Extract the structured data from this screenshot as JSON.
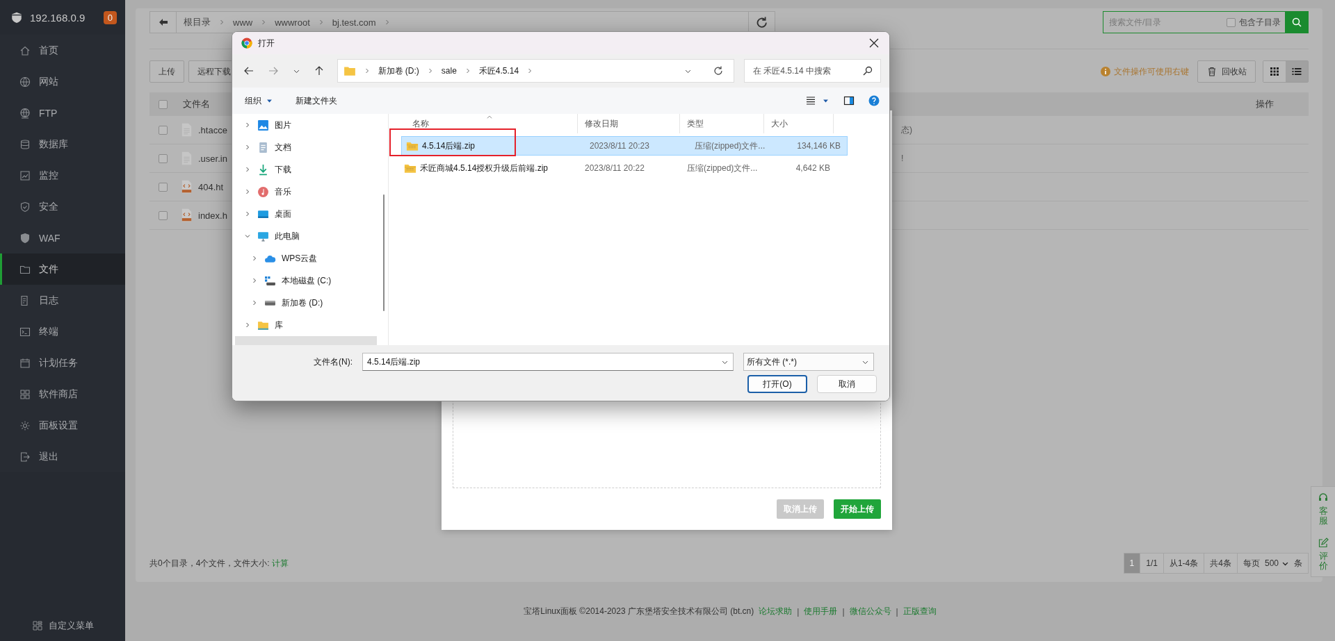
{
  "sidebar": {
    "host": "192.168.0.9",
    "badge": "0",
    "items": [
      {
        "label": "首页",
        "selected": false
      },
      {
        "label": "网站",
        "selected": false
      },
      {
        "label": "FTP",
        "selected": false
      },
      {
        "label": "数据库",
        "selected": false
      },
      {
        "label": "监控",
        "selected": false
      },
      {
        "label": "安全",
        "selected": false
      },
      {
        "label": "WAF",
        "selected": false
      },
      {
        "label": "文件",
        "selected": true
      },
      {
        "label": "日志",
        "selected": false
      },
      {
        "label": "终端",
        "selected": false
      },
      {
        "label": "计划任务",
        "selected": false
      },
      {
        "label": "软件商店",
        "selected": false
      },
      {
        "label": "面板设置",
        "selected": false
      },
      {
        "label": "退出",
        "selected": false
      }
    ],
    "custom_menu": "自定义菜单"
  },
  "file_manager": {
    "breadcrumb": [
      "根目录",
      "www",
      "wwwroot",
      "bj.test.com"
    ],
    "search": {
      "placeholder": "搜索文件/目录",
      "subdir_label": "包含子目录",
      "subdir_checked": false
    },
    "buttons": [
      "上传",
      "远程下载"
    ],
    "hint": "文件操作可使用右键",
    "recycle_bin": "回收站",
    "views": [
      {
        "kind": "grid",
        "selected": false
      },
      {
        "kind": "list",
        "selected": true
      }
    ],
    "columns": [
      "文件名",
      "操作"
    ],
    "select_all_checked": false,
    "rows": [
      {
        "name": ".htacce",
        "kind": "text",
        "checked": false,
        "column_3": "态)"
      },
      {
        "name": ".user.in",
        "kind": "text",
        "checked": false,
        "column_3": "!"
      },
      {
        "name": "404.ht",
        "kind": "html",
        "checked": false
      },
      {
        "name": "index.h",
        "kind": "html",
        "checked": false
      }
    ],
    "summary": "共0个目录，4个文件，文件大小: ",
    "calc_link": "计算",
    "pagination": {
      "pages": [
        {
          "label": "1",
          "selected": true
        }
      ],
      "page_count": "1/1",
      "range": "从1-4条",
      "total": "共4条",
      "per_page_label": "每页",
      "per_page": "500",
      "unit": "条"
    }
  },
  "upload_dialog": {
    "cancel": {
      "label": "取消上传",
      "disabled": true
    },
    "start": {
      "label": "开始上传",
      "disabled": false
    }
  },
  "footer": {
    "copyright": "宝塔Linux面板 ©2014-2023 广东堡塔安全技术有限公司 (bt.cn)",
    "links": [
      "论坛求助",
      "使用手册",
      "微信公众号",
      "正版查询"
    ],
    "separator": "|"
  },
  "float_panel": [
    "客服",
    "评价"
  ],
  "open_dialog": {
    "title": "打开",
    "path": [
      "新加卷 (D:)",
      "sale",
      "禾匠4.5.14"
    ],
    "search_placeholder": "在 禾匠4.5.14 中搜索",
    "commands": [
      {
        "label": "组织",
        "dropdown": true
      },
      {
        "label": "新建文件夹",
        "dropdown": false
      }
    ],
    "nav": [
      {
        "label": "图片",
        "expanded": false,
        "selected": false
      },
      {
        "label": "文档",
        "expanded": false,
        "selected": false
      },
      {
        "label": "下载",
        "expanded": false,
        "selected": false
      },
      {
        "label": "音乐",
        "expanded": false,
        "selected": false
      },
      {
        "label": "桌面",
        "expanded": false,
        "selected": false
      },
      {
        "label": "此电脑",
        "expanded": true,
        "selected": false,
        "children": [
          {
            "label": "WPS云盘",
            "expanded": false,
            "selected": false
          },
          {
            "label": "本地磁盘 (C:)",
            "expanded": false,
            "selected": false
          },
          {
            "label": "新加卷 (D:)",
            "expanded": false,
            "selected": false
          }
        ]
      },
      {
        "label": "库",
        "expanded": false,
        "selected": false
      },
      {
        "selected": true
      }
    ],
    "columns": [
      {
        "label": "名称",
        "sorted": true
      },
      {
        "label": "修改日期",
        "sorted": false
      },
      {
        "label": "类型",
        "sorted": false
      },
      {
        "label": "大小",
        "sorted": false
      }
    ],
    "files": [
      {
        "name": "4.5.14后端.zip",
        "date": "2023/8/11 20:23",
        "type": "压缩(zipped)文件...",
        "size": "134,146 KB",
        "selected": true,
        "annotated": true
      },
      {
        "name": "禾匠商城4.5.14授权升级后前端.zip",
        "date": "2023/8/11 20:22",
        "type": "压缩(zipped)文件...",
        "size": "4,642 KB",
        "selected": false,
        "annotated": false
      }
    ],
    "filename_label": "文件名(N):",
    "filename": "4.5.14后端.zip",
    "filter": "所有文件 (*.*)",
    "open": "打开(O)",
    "cancel": "取消"
  }
}
